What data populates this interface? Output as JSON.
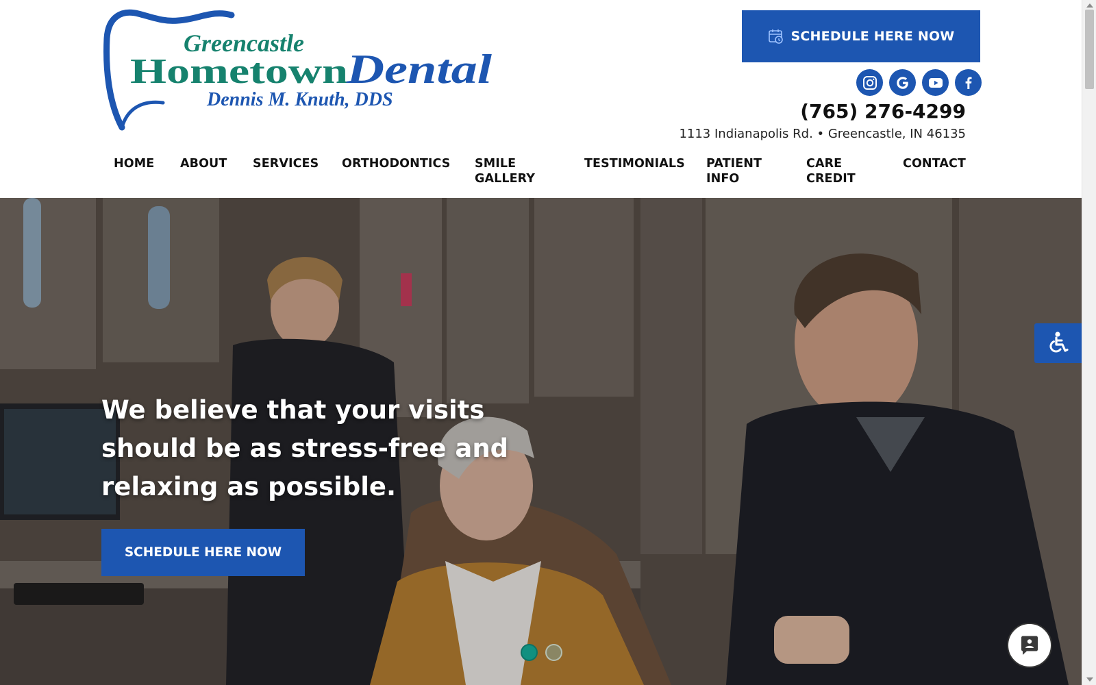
{
  "brand": {
    "line1": "Greencastle",
    "line2a": "Hometown",
    "line2b": "Dental",
    "line3": "Dennis M. Knuth, DDS",
    "colors": {
      "blue": "#1d56b1",
      "green": "#16826e"
    }
  },
  "header": {
    "schedule_label": "SCHEDULE HERE NOW",
    "schedule_icon": "calendar-clock-icon",
    "socials": [
      {
        "name": "instagram",
        "icon": "instagram-icon"
      },
      {
        "name": "google",
        "icon": "google-icon"
      },
      {
        "name": "youtube",
        "icon": "youtube-icon"
      },
      {
        "name": "facebook",
        "icon": "facebook-icon"
      }
    ],
    "phone": "(765) 276-4299",
    "address": "1113 Indianapolis Rd. • Greencastle, IN 46135"
  },
  "nav": {
    "items": [
      {
        "line1": "HOME",
        "line2": ""
      },
      {
        "line1": "ABOUT",
        "line2": ""
      },
      {
        "line1": "SERVICES",
        "line2": ""
      },
      {
        "line1": "ORTHODONTICS",
        "line2": ""
      },
      {
        "line1": "SMILE",
        "line2": "GALLERY"
      },
      {
        "line1": "TESTIMONIALS",
        "line2": ""
      },
      {
        "line1": "PATIENT",
        "line2": "INFO"
      },
      {
        "line1": "CARE",
        "line2": "CREDIT"
      },
      {
        "line1": "CONTACT",
        "line2": ""
      }
    ]
  },
  "hero": {
    "headline": "We believe that your visits should be as stress-free and relaxing as possible.",
    "cta_label": "SCHEDULE HERE NOW",
    "slides": {
      "count": 2,
      "active": 1
    }
  },
  "widgets": {
    "accessibility_icon": "wheelchair-icon",
    "chat_icon": "chat-bubble-icon"
  }
}
